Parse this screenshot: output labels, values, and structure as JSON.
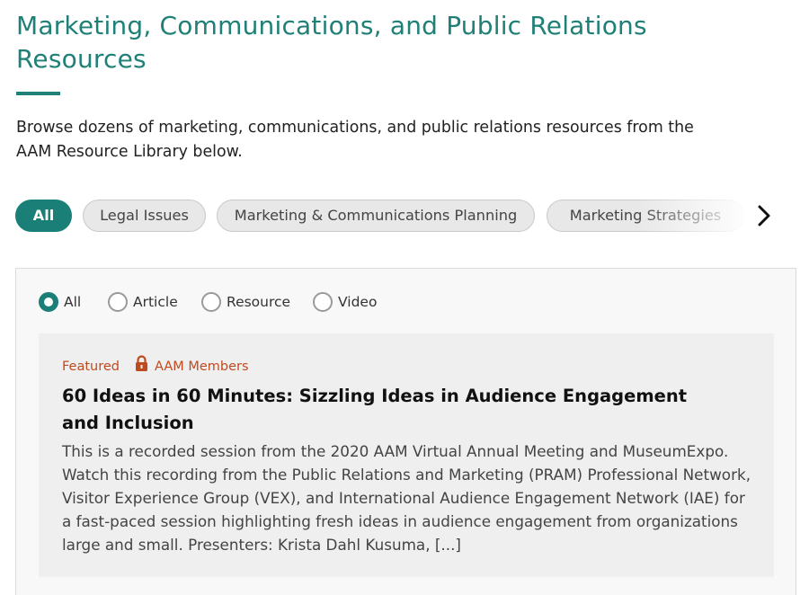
{
  "header": {
    "title": "Marketing, Communications, and Public Relations Resources",
    "intro": "Browse dozens of marketing, communications, and public relations resources from the AAM Resource Library below."
  },
  "filters": {
    "pills": [
      {
        "label": "All",
        "active": true
      },
      {
        "label": "Legal Issues",
        "active": false
      },
      {
        "label": "Marketing & Communications Planning",
        "active": false
      },
      {
        "label": "Marketing Strategies",
        "active": false
      }
    ],
    "next_icon": "chevron-right-icon"
  },
  "type_filter": {
    "options": [
      {
        "label": "All",
        "checked": true
      },
      {
        "label": "Article",
        "checked": false
      },
      {
        "label": "Resource",
        "checked": false
      },
      {
        "label": "Video",
        "checked": false
      }
    ]
  },
  "results": [
    {
      "featured_label": "Featured",
      "access_icon": "lock-icon",
      "access_label": "AAM Members",
      "title": "60 Ideas in 60 Minutes: Sizzling Ideas in Audience Engagement and Inclusion",
      "description": "This is a recorded session from the 2020 AAM Virtual Annual Meeting and MuseumExpo. Watch this recording from the Public Relations and Marketing (PRAM) Professional Network, Visitor Experience Group (VEX), and International Audience Engagement Network (IAE) for a fast-paced session highlighting fresh ideas in audience engagement from organizations large and small. Presenters: Krista Dahl Kusuma, [...]"
    }
  ],
  "colors": {
    "brand_teal": "#1f8077",
    "accent_orange": "#c04a1f"
  }
}
